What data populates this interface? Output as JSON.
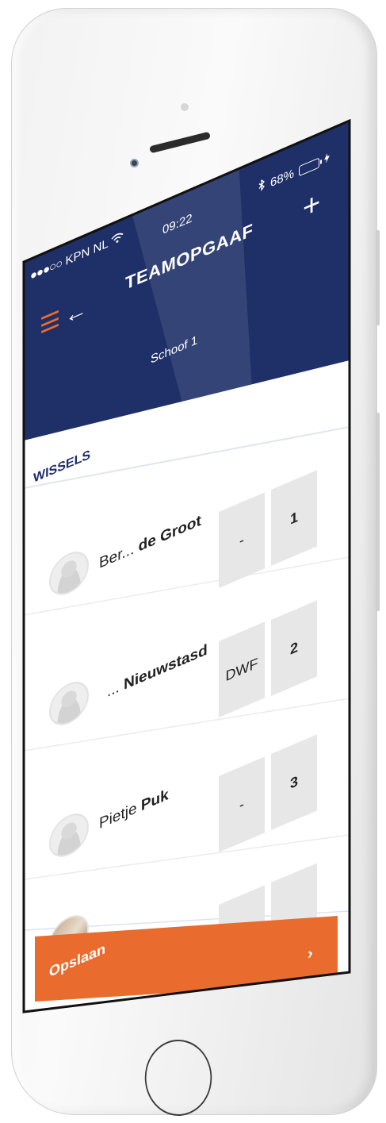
{
  "status_bar": {
    "carrier": "KPN NL",
    "signal_dots": "●●●○○",
    "time": "09:22",
    "battery_percent": "68%",
    "battery_level": 0.68
  },
  "header": {
    "title": "TEAMOPGAAF",
    "subtitle": "Schoof 1",
    "add_label": "+",
    "back_label": "←",
    "icons": [
      "menu-icon",
      "back-arrow-icon",
      "plus-icon",
      "wifi-icon",
      "bluetooth-icon",
      "battery-icon",
      "charging-icon"
    ]
  },
  "section": {
    "label": "WISSELS"
  },
  "players": [
    {
      "first": "Ber...",
      "last": "de Groot",
      "status": "-",
      "number": "1"
    },
    {
      "first": "...",
      "last": "Nieuwstasd",
      "status": "DWF",
      "number": "2"
    },
    {
      "first": "Pietje",
      "last": "Puk",
      "status": "-",
      "number": "3"
    },
    {
      "first": "",
      "last": "",
      "status": "",
      "number": ""
    }
  ],
  "footer": {
    "save_label": "Opslaan",
    "chevron": "›"
  },
  "colors": {
    "header_navy": "#1f2f68",
    "accent_orange": "#ea6b2e",
    "cell_grey": "#e7e7e7"
  }
}
